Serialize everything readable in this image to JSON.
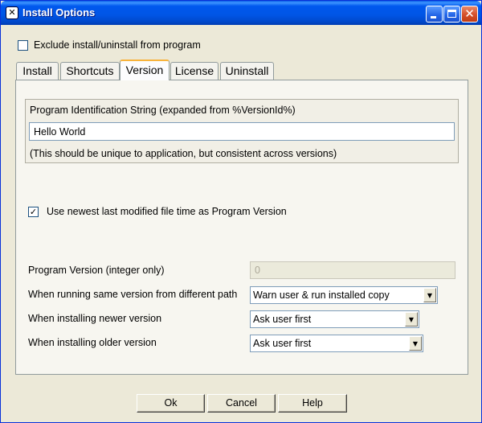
{
  "window": {
    "title": "Install Options",
    "app_icon": "app-icon",
    "app_icon_glyph": "✕",
    "controls": {
      "minimize": "minimize-icon",
      "maximize": "maximize-icon",
      "close_glyph": "✕"
    }
  },
  "exclude": {
    "label": "Exclude install/uninstall from program",
    "checked": false
  },
  "tabs": [
    {
      "label": "Install",
      "active": false
    },
    {
      "label": "Shortcuts",
      "active": false
    },
    {
      "label": "Version",
      "active": true
    },
    {
      "label": "License",
      "active": false
    },
    {
      "label": "Uninstall",
      "active": false
    }
  ],
  "version": {
    "id_group_label": "Program Identification String (expanded from %VersionId%)",
    "id_value": "Hello World",
    "id_note": "(This should be unique to application, but consistent across versions)",
    "use_newest": {
      "label": "Use newest last modified file time as Program Version",
      "checked": true,
      "mark": "✓"
    },
    "program_version_label": "Program Version (integer only)",
    "program_version_value": "0",
    "same_version_label": "When running same version from different path",
    "same_version_value": "Warn user & run installed copy",
    "newer_label": "When installing newer version",
    "newer_value": "Ask user first",
    "older_label": "When installing older version",
    "older_value": "Ask user first",
    "dropdown_arrow": "▼"
  },
  "buttons": {
    "ok": "Ok",
    "cancel": "Cancel",
    "help": "Help"
  }
}
